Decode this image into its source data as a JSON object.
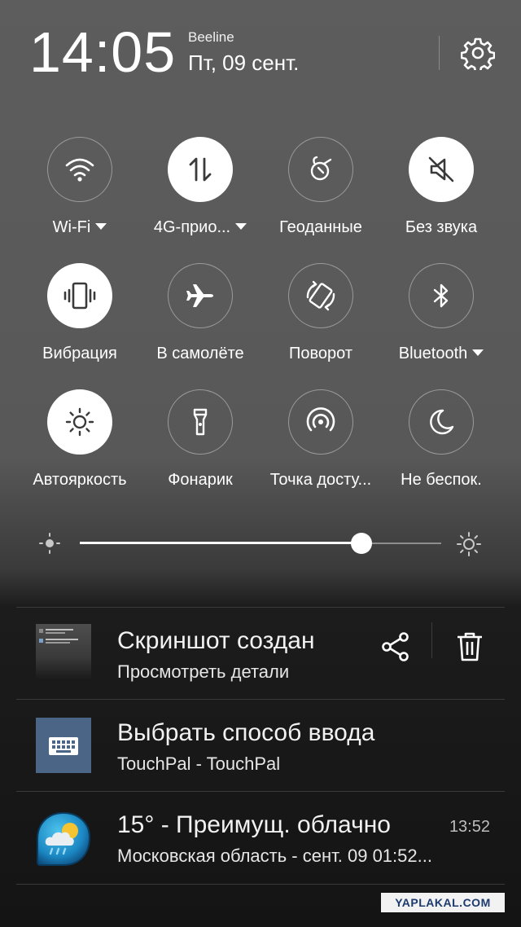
{
  "status": {
    "time": "14:05",
    "operator": "Beeline",
    "date": "Пт, 09 сент."
  },
  "tiles": [
    {
      "label": "Wi-Fi",
      "icon": "wifi-icon",
      "active": false,
      "dropdown": true
    },
    {
      "label": "4G-прио...",
      "icon": "mobile-data-icon",
      "active": true,
      "dropdown": true
    },
    {
      "label": "Геоданные",
      "icon": "location-icon",
      "active": false,
      "dropdown": false
    },
    {
      "label": "Без звука",
      "icon": "mute-icon",
      "active": true,
      "dropdown": false
    },
    {
      "label": "Вибрация",
      "icon": "vibration-icon",
      "active": true,
      "dropdown": false
    },
    {
      "label": "В самолёте",
      "icon": "airplane-icon",
      "active": false,
      "dropdown": false
    },
    {
      "label": "Поворот",
      "icon": "rotation-icon",
      "active": false,
      "dropdown": false
    },
    {
      "label": "Bluetooth",
      "icon": "bluetooth-icon",
      "active": false,
      "dropdown": true
    },
    {
      "label": "Автояркость",
      "icon": "auto-brightness-icon",
      "active": true,
      "dropdown": false
    },
    {
      "label": "Фонарик",
      "icon": "flashlight-icon",
      "active": false,
      "dropdown": false
    },
    {
      "label": "Точка досту...",
      "icon": "hotspot-icon",
      "active": false,
      "dropdown": false
    },
    {
      "label": "Не беспок.",
      "icon": "do-not-disturb-icon",
      "active": false,
      "dropdown": false
    }
  ],
  "brightness": {
    "level": 0.78
  },
  "notifications": [
    {
      "title": "Скриншот создан",
      "subtitle": "Просмотреть детали",
      "icon": "screenshot-thumbnail"
    },
    {
      "title": "Выбрать способ ввода",
      "subtitle": "TouchPal - TouchPal",
      "icon": "keyboard-icon"
    },
    {
      "title": "15° -  Преимущ. облачно",
      "subtitle": "Московская область - сент. 09  01:52...",
      "time": "13:52",
      "icon": "weather-icon"
    }
  ],
  "watermark": "YAPLAKAL.COM",
  "colors": {
    "tile_active": "#ffffff",
    "tile_outline": "#9a9a9a",
    "keyboard_tile": "#4a6585",
    "weather_accent": "#2aa3d8"
  }
}
